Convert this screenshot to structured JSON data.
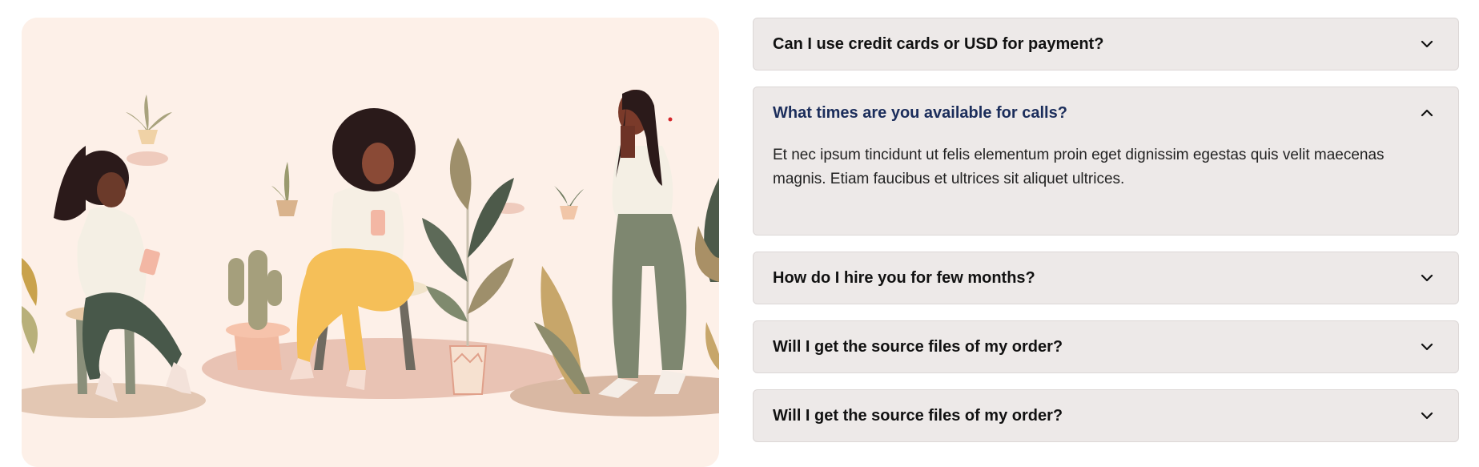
{
  "faq": {
    "items": [
      {
        "question": "Can I use credit cards or USD for payment?",
        "expanded": false,
        "toggle_icon": "chevron-down-icon"
      },
      {
        "question": "What times are you available for calls?",
        "expanded": true,
        "toggle_icon": "chevron-up-icon",
        "answer": "Et nec ipsum tincidunt ut felis elementum proin eget dignissim egestas quis velit maecenas magnis. Etiam faucibus et ultrices sit aliquet ultrices."
      },
      {
        "question": "How do I hire you for few months?",
        "expanded": false,
        "toggle_icon": "chevron-down-icon"
      },
      {
        "question": "Will I get the source files of my order?",
        "expanded": false,
        "toggle_icon": "chevron-down-icon"
      },
      {
        "question": "Will I get the source files of my order?",
        "expanded": false,
        "toggle_icon": "chevron-down-icon"
      }
    ]
  },
  "colors": {
    "illustration_bg": "#fdf0e8",
    "accordion_bg": "#ede9e8",
    "active_question": "#1b2d5b"
  }
}
